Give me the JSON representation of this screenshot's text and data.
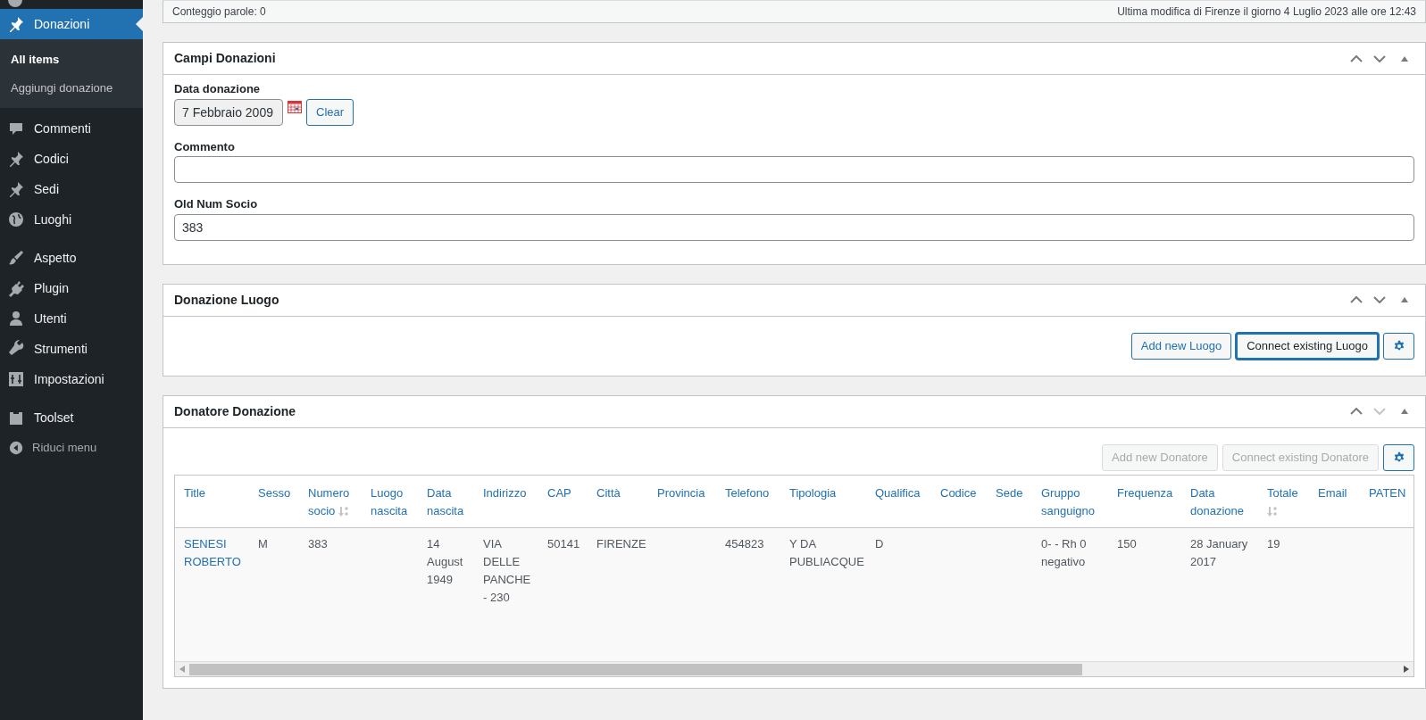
{
  "sidebar": {
    "items": [
      {
        "label": "Donazioni",
        "kind": "pin",
        "selected": true,
        "children": [
          {
            "label": "All items",
            "selected": true
          },
          {
            "label": "Aggiungi donazione",
            "selected": false
          }
        ]
      },
      {
        "label": "Commenti",
        "kind": "comment",
        "selected": false
      },
      {
        "label": "Codici",
        "kind": "pin",
        "selected": false
      },
      {
        "label": "Sedi",
        "kind": "pin",
        "selected": false
      },
      {
        "label": "Luoghi",
        "kind": "globe",
        "selected": false
      },
      {
        "label": "Aspetto",
        "kind": "brush",
        "selected": false
      },
      {
        "label": "Plugin",
        "kind": "plug",
        "selected": false
      },
      {
        "label": "Utenti",
        "kind": "user",
        "selected": false
      },
      {
        "label": "Strumenti",
        "kind": "wrench",
        "selected": false
      },
      {
        "label": "Impostazioni",
        "kind": "sliders",
        "selected": false
      },
      {
        "label": "Toolset",
        "kind": "toolset",
        "selected": false
      },
      {
        "label": "Riduci menu",
        "kind": "collapse"
      }
    ]
  },
  "status_bar": {
    "word_count": "Conteggio parole: 0",
    "last_modified": "Ultima modifica di Firenze il giorno 4 Luglio 2023 alle ore 12:43"
  },
  "panels": [
    {
      "title": "Campi Donazioni",
      "kind": "fields",
      "move_down_disabled": false,
      "fields": [
        {
          "label": "Data donazione",
          "kind": "date",
          "value": "7 Febbraio 2009",
          "button": "Clear"
        },
        {
          "label": "Commento",
          "kind": "text"
        },
        {
          "label": "Old Num Socio",
          "kind": "text",
          "value": "383"
        }
      ]
    },
    {
      "title": "Donazione Luogo",
      "kind": "relationship",
      "move_down_disabled": false,
      "buttons": [
        {
          "label": "Add new Luogo",
          "disabled": false,
          "focused": false
        },
        {
          "label": "Connect existing Luogo",
          "disabled": false,
          "focused": true
        }
      ]
    },
    {
      "title": "Donatore Donazione",
      "kind": "relationship",
      "move_down_disabled": true,
      "buttons": [
        {
          "label": "Add new Donatore",
          "disabled": true,
          "focused": false
        },
        {
          "label": "Connect existing Donatore",
          "disabled": true,
          "focused": false
        }
      ],
      "table": {
        "columns": [
          {
            "label": "Title",
            "sortable": false
          },
          {
            "label": "Sesso",
            "sortable": false
          },
          {
            "label": "Numero socio",
            "sortable": true
          },
          {
            "label": "Luogo nascita",
            "sortable": false
          },
          {
            "label": "Data nascita",
            "sortable": false
          },
          {
            "label": "Indirizzo",
            "sortable": false
          },
          {
            "label": "CAP",
            "sortable": false
          },
          {
            "label": "Città",
            "sortable": false
          },
          {
            "label": "Provincia",
            "sortable": false
          },
          {
            "label": "Telefono",
            "sortable": false
          },
          {
            "label": "Tipologia",
            "sortable": false
          },
          {
            "label": "Qualifica",
            "sortable": false
          },
          {
            "label": "Codice",
            "sortable": false
          },
          {
            "label": "Sede",
            "sortable": false
          },
          {
            "label": "Gruppo sanguigno",
            "sortable": false
          },
          {
            "label": "Frequenza",
            "sortable": false
          },
          {
            "label": "Data donazione",
            "sortable": false
          },
          {
            "label": "Totale",
            "sortable": true
          },
          {
            "label": "Email",
            "sortable": false
          },
          {
            "label": "PATEN",
            "sortable": false
          }
        ],
        "rows": [
          [
            "SENESI ROBERTO",
            "M",
            "383",
            "",
            "14 August 1949",
            "VIA DELLE PANCHE - 230",
            "50141",
            "FIRENZE",
            "",
            "454823",
            "Y DA PUBLIACQUE",
            "D",
            "",
            "",
            "0- - Rh 0 negativo",
            "150",
            "28 January 2017",
            "19",
            "",
            ""
          ]
        ]
      }
    }
  ]
}
